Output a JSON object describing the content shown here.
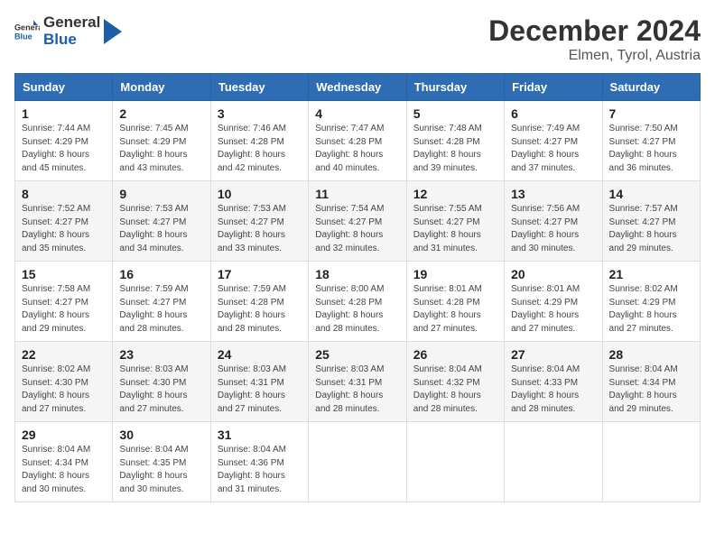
{
  "header": {
    "logo": {
      "general": "General",
      "blue": "Blue"
    },
    "title": "December 2024",
    "location": "Elmen, Tyrol, Austria"
  },
  "columns": [
    "Sunday",
    "Monday",
    "Tuesday",
    "Wednesday",
    "Thursday",
    "Friday",
    "Saturday"
  ],
  "weeks": [
    [
      {
        "day": "1",
        "sunrise": "Sunrise: 7:44 AM",
        "sunset": "Sunset: 4:29 PM",
        "daylight": "Daylight: 8 hours and 45 minutes."
      },
      {
        "day": "2",
        "sunrise": "Sunrise: 7:45 AM",
        "sunset": "Sunset: 4:29 PM",
        "daylight": "Daylight: 8 hours and 43 minutes."
      },
      {
        "day": "3",
        "sunrise": "Sunrise: 7:46 AM",
        "sunset": "Sunset: 4:28 PM",
        "daylight": "Daylight: 8 hours and 42 minutes."
      },
      {
        "day": "4",
        "sunrise": "Sunrise: 7:47 AM",
        "sunset": "Sunset: 4:28 PM",
        "daylight": "Daylight: 8 hours and 40 minutes."
      },
      {
        "day": "5",
        "sunrise": "Sunrise: 7:48 AM",
        "sunset": "Sunset: 4:28 PM",
        "daylight": "Daylight: 8 hours and 39 minutes."
      },
      {
        "day": "6",
        "sunrise": "Sunrise: 7:49 AM",
        "sunset": "Sunset: 4:27 PM",
        "daylight": "Daylight: 8 hours and 37 minutes."
      },
      {
        "day": "7",
        "sunrise": "Sunrise: 7:50 AM",
        "sunset": "Sunset: 4:27 PM",
        "daylight": "Daylight: 8 hours and 36 minutes."
      }
    ],
    [
      {
        "day": "8",
        "sunrise": "Sunrise: 7:52 AM",
        "sunset": "Sunset: 4:27 PM",
        "daylight": "Daylight: 8 hours and 35 minutes."
      },
      {
        "day": "9",
        "sunrise": "Sunrise: 7:53 AM",
        "sunset": "Sunset: 4:27 PM",
        "daylight": "Daylight: 8 hours and 34 minutes."
      },
      {
        "day": "10",
        "sunrise": "Sunrise: 7:53 AM",
        "sunset": "Sunset: 4:27 PM",
        "daylight": "Daylight: 8 hours and 33 minutes."
      },
      {
        "day": "11",
        "sunrise": "Sunrise: 7:54 AM",
        "sunset": "Sunset: 4:27 PM",
        "daylight": "Daylight: 8 hours and 32 minutes."
      },
      {
        "day": "12",
        "sunrise": "Sunrise: 7:55 AM",
        "sunset": "Sunset: 4:27 PM",
        "daylight": "Daylight: 8 hours and 31 minutes."
      },
      {
        "day": "13",
        "sunrise": "Sunrise: 7:56 AM",
        "sunset": "Sunset: 4:27 PM",
        "daylight": "Daylight: 8 hours and 30 minutes."
      },
      {
        "day": "14",
        "sunrise": "Sunrise: 7:57 AM",
        "sunset": "Sunset: 4:27 PM",
        "daylight": "Daylight: 8 hours and 29 minutes."
      }
    ],
    [
      {
        "day": "15",
        "sunrise": "Sunrise: 7:58 AM",
        "sunset": "Sunset: 4:27 PM",
        "daylight": "Daylight: 8 hours and 29 minutes."
      },
      {
        "day": "16",
        "sunrise": "Sunrise: 7:59 AM",
        "sunset": "Sunset: 4:27 PM",
        "daylight": "Daylight: 8 hours and 28 minutes."
      },
      {
        "day": "17",
        "sunrise": "Sunrise: 7:59 AM",
        "sunset": "Sunset: 4:28 PM",
        "daylight": "Daylight: 8 hours and 28 minutes."
      },
      {
        "day": "18",
        "sunrise": "Sunrise: 8:00 AM",
        "sunset": "Sunset: 4:28 PM",
        "daylight": "Daylight: 8 hours and 28 minutes."
      },
      {
        "day": "19",
        "sunrise": "Sunrise: 8:01 AM",
        "sunset": "Sunset: 4:28 PM",
        "daylight": "Daylight: 8 hours and 27 minutes."
      },
      {
        "day": "20",
        "sunrise": "Sunrise: 8:01 AM",
        "sunset": "Sunset: 4:29 PM",
        "daylight": "Daylight: 8 hours and 27 minutes."
      },
      {
        "day": "21",
        "sunrise": "Sunrise: 8:02 AM",
        "sunset": "Sunset: 4:29 PM",
        "daylight": "Daylight: 8 hours and 27 minutes."
      }
    ],
    [
      {
        "day": "22",
        "sunrise": "Sunrise: 8:02 AM",
        "sunset": "Sunset: 4:30 PM",
        "daylight": "Daylight: 8 hours and 27 minutes."
      },
      {
        "day": "23",
        "sunrise": "Sunrise: 8:03 AM",
        "sunset": "Sunset: 4:30 PM",
        "daylight": "Daylight: 8 hours and 27 minutes."
      },
      {
        "day": "24",
        "sunrise": "Sunrise: 8:03 AM",
        "sunset": "Sunset: 4:31 PM",
        "daylight": "Daylight: 8 hours and 27 minutes."
      },
      {
        "day": "25",
        "sunrise": "Sunrise: 8:03 AM",
        "sunset": "Sunset: 4:31 PM",
        "daylight": "Daylight: 8 hours and 28 minutes."
      },
      {
        "day": "26",
        "sunrise": "Sunrise: 8:04 AM",
        "sunset": "Sunset: 4:32 PM",
        "daylight": "Daylight: 8 hours and 28 minutes."
      },
      {
        "day": "27",
        "sunrise": "Sunrise: 8:04 AM",
        "sunset": "Sunset: 4:33 PM",
        "daylight": "Daylight: 8 hours and 28 minutes."
      },
      {
        "day": "28",
        "sunrise": "Sunrise: 8:04 AM",
        "sunset": "Sunset: 4:34 PM",
        "daylight": "Daylight: 8 hours and 29 minutes."
      }
    ],
    [
      {
        "day": "29",
        "sunrise": "Sunrise: 8:04 AM",
        "sunset": "Sunset: 4:34 PM",
        "daylight": "Daylight: 8 hours and 30 minutes."
      },
      {
        "day": "30",
        "sunrise": "Sunrise: 8:04 AM",
        "sunset": "Sunset: 4:35 PM",
        "daylight": "Daylight: 8 hours and 30 minutes."
      },
      {
        "day": "31",
        "sunrise": "Sunrise: 8:04 AM",
        "sunset": "Sunset: 4:36 PM",
        "daylight": "Daylight: 8 hours and 31 minutes."
      },
      null,
      null,
      null,
      null
    ]
  ]
}
